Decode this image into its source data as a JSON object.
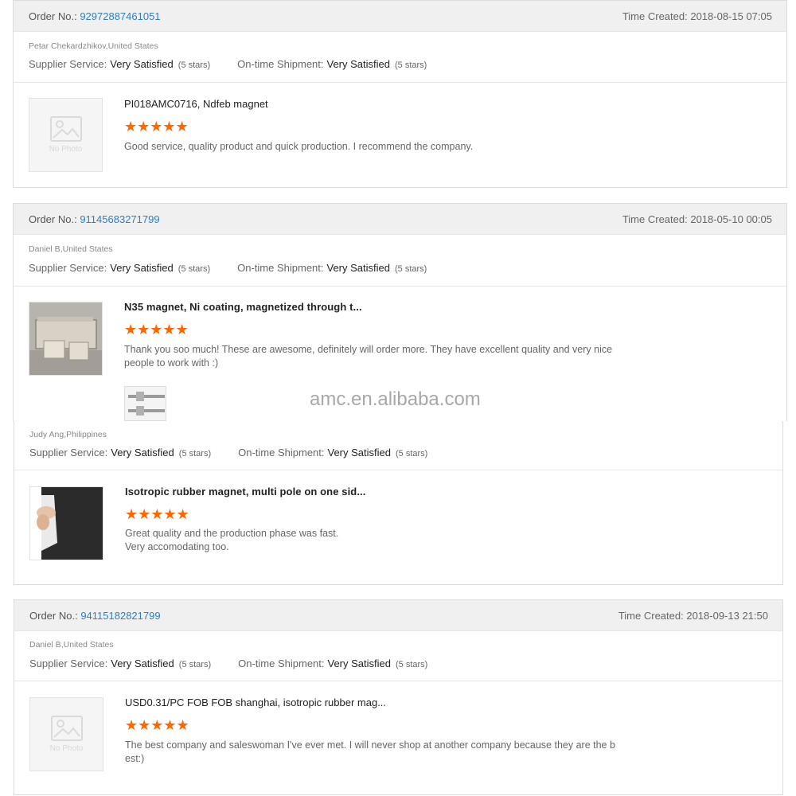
{
  "order_label": "Order No.:",
  "time_label": "Time Created:",
  "supplier_service_label": "Supplier Service:",
  "shipment_label": "On-time Shipment:",
  "no_photo_text": "No Photo",
  "star_color": "#ff6600",
  "link_color": "#2f7fc1",
  "watermark": "amc.en.alibaba.com",
  "reviews": [
    {
      "order_no": "92972887461051",
      "time_created": "2018-08-15 07:05",
      "buyer": "Petar Chekardzhikov,United States",
      "supplier_service": "Very Satisfied",
      "supplier_service_stars": "(5 stars)",
      "shipment": "Very Satisfied",
      "shipment_stars": "(5 stars)",
      "product_title": "PI018AMC0716, Ndfeb magnet",
      "rating": "★★★★★",
      "comment": "Good service, quality product and quick production. I recommend the company."
    },
    {
      "order_no": "91145683271799",
      "time_created": "2018-05-10 00:05",
      "buyer": "Daniel B,United States",
      "supplier_service": "Very Satisfied",
      "supplier_service_stars": "(5 stars)",
      "shipment": "Very Satisfied",
      "shipment_stars": "(5 stars)",
      "product_title": "N35 magnet, Ni coating, magnetized through t...",
      "rating": "★★★★★",
      "comment": "Thank you soo much! These are awesome, definitely will order more. They have excellent quality and very nice people to work with :)"
    },
    {
      "buyer": "Judy Ang,Philippines",
      "supplier_service": "Very Satisfied",
      "supplier_service_stars": "(5 stars)",
      "shipment": "Very Satisfied",
      "shipment_stars": "(5 stars)",
      "product_title": "Isotropic rubber magnet, multi pole on one sid...",
      "rating": "★★★★★",
      "comment_line1": "Great quality and the production phase was fast.",
      "comment_line2": "Very accomodating too."
    },
    {
      "order_no": "94115182821799",
      "time_created": "2018-09-13 21:50",
      "buyer": "Daniel B,United States",
      "supplier_service": "Very Satisfied",
      "supplier_service_stars": "(5 stars)",
      "shipment": "Very Satisfied",
      "shipment_stars": "(5 stars)",
      "product_title": "USD0.31/PC FOB FOB shanghai, isotropic rubber mag...",
      "rating": "★★★★★",
      "comment": "The best company and saleswoman I've ever met. I will never shop at another company because they are the best:)"
    }
  ]
}
